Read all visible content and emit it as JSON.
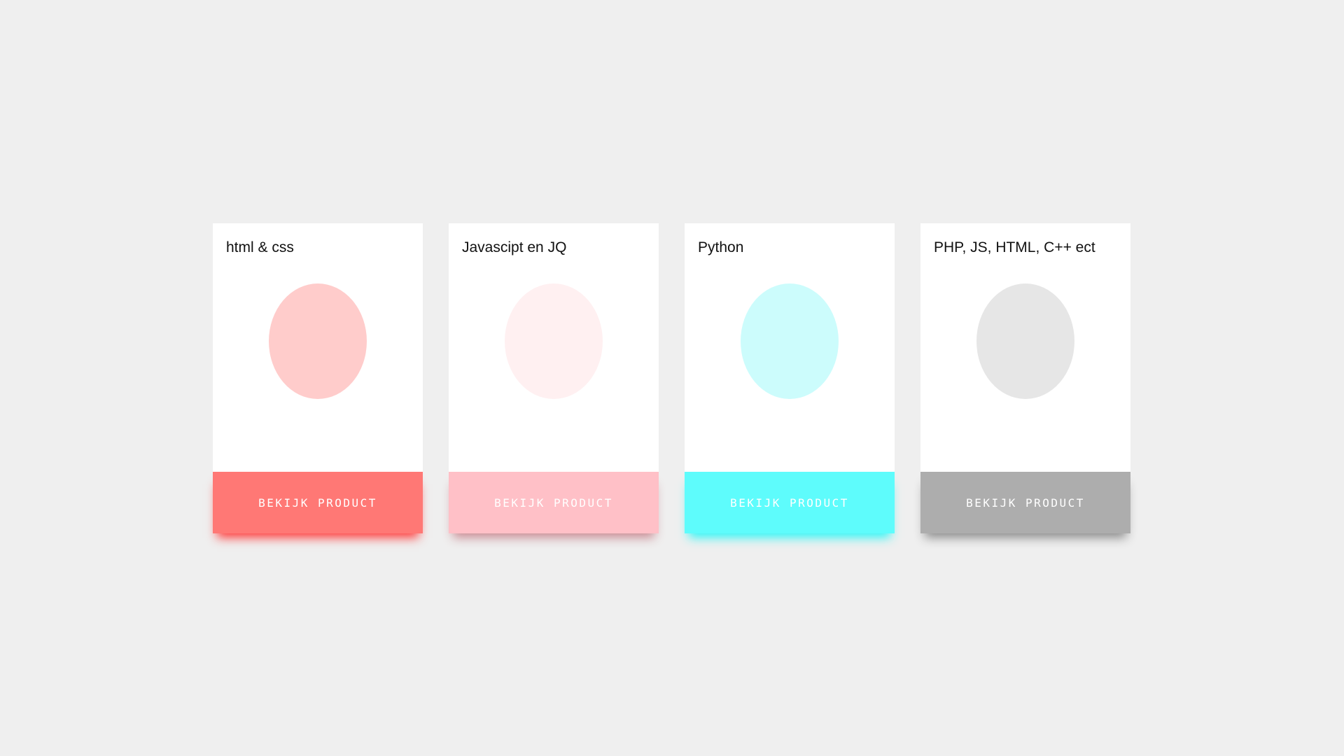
{
  "cards": [
    {
      "title": "html & css",
      "button_label": "BEKIJK PRODUCT",
      "circle_color": "#ffcccb",
      "button_color": "#ff7875",
      "glow_color": "#ff3a3a"
    },
    {
      "title": "Javascipt en JQ",
      "button_label": "BEKIJK PRODUCT",
      "circle_color": "#fff0f1",
      "button_color": "#ffc0c7",
      "glow_color": "#c98a92"
    },
    {
      "title": "Python",
      "button_label": "BEKIJK PRODUCT",
      "circle_color": "#ccfcfc",
      "button_color": "#5efcfc",
      "glow_color": "#2ef6f6"
    },
    {
      "title": "PHP, JS, HTML, C++ ect",
      "button_label": "BEKIJK PRODUCT",
      "circle_color": "#e6e6e6",
      "button_color": "#adadad",
      "glow_color": "#8a8a8a"
    }
  ]
}
